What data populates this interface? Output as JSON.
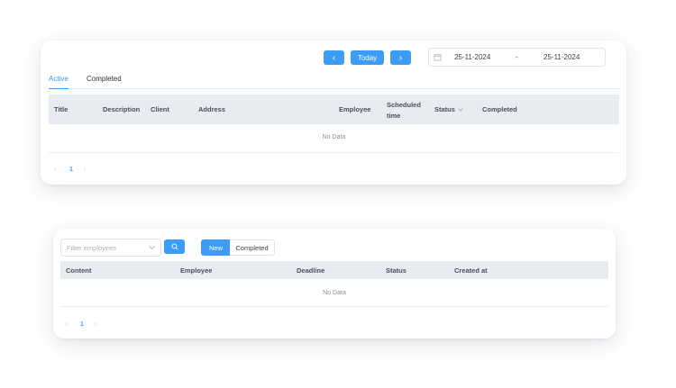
{
  "panel1": {
    "prev_label": "‹",
    "today_label": "Today",
    "next_label": "›",
    "date_start": "25-11-2024",
    "date_separator": "-",
    "date_end": "25-11-2024",
    "tabs": [
      {
        "label": "Active"
      },
      {
        "label": "Completed"
      }
    ],
    "columns": [
      "Title",
      "Description",
      "Client",
      "Address",
      "Employee",
      "Scheduled time",
      "Status",
      "Completed"
    ],
    "empty_text": "No Data",
    "pager": {
      "prev": "‹",
      "page": "1",
      "next": "›"
    }
  },
  "panel2": {
    "filter_placeholder": "Filter employees",
    "segments": [
      {
        "label": "New"
      },
      {
        "label": "Completed"
      }
    ],
    "columns": [
      "Content",
      "Employee",
      "Deadline",
      "Status",
      "Created at"
    ],
    "empty_text": "No Data",
    "pager": {
      "prev": "‹",
      "page": "1",
      "next": "›"
    }
  },
  "colors": {
    "accent": "#3d9cf5",
    "header_bg": "#e8ebef"
  }
}
